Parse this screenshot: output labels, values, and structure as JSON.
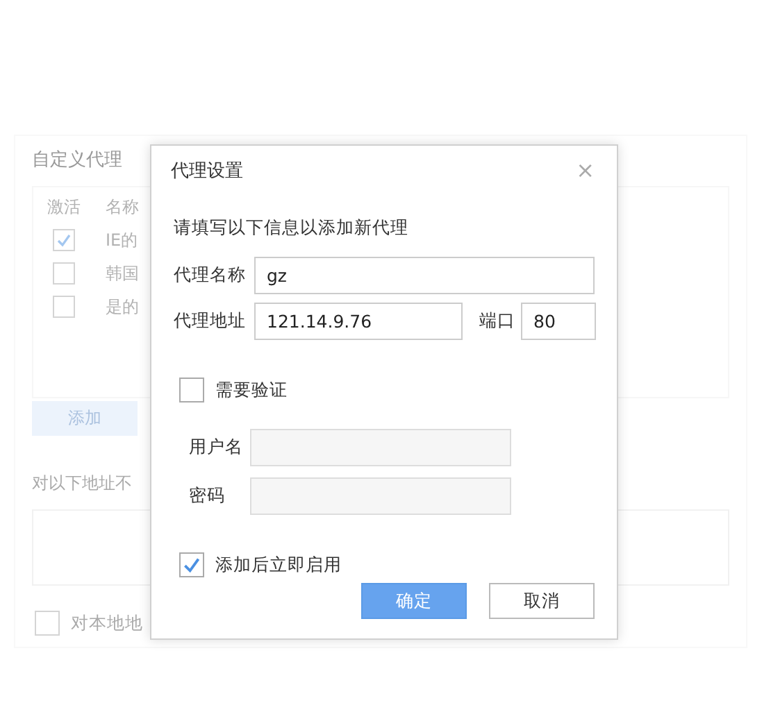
{
  "background_panel": {
    "title": "自定义代理",
    "columns": [
      "激活",
      "名称"
    ],
    "rows": [
      {
        "checked": true,
        "name": "IE的"
      },
      {
        "checked": false,
        "name": "韩国"
      },
      {
        "checked": false,
        "name": "是的"
      }
    ],
    "add_button": "添加",
    "bypass_label": "对以下地址不",
    "local_checkbox": {
      "label": "对本地地",
      "checked": false
    }
  },
  "dialog": {
    "title": "代理设置",
    "close": "×",
    "intro": "请填写以下信息以添加新代理",
    "name_field": {
      "label": "代理名称",
      "value": "gz"
    },
    "address_field": {
      "label": "代理地址",
      "value": "121.14.9.76"
    },
    "port_field": {
      "label": "端口",
      "value": "80"
    },
    "auth_checkbox": {
      "label": "需要验证",
      "checked": false
    },
    "username_field": {
      "label": "用户名",
      "disabled": true
    },
    "password_field": {
      "label": "密码",
      "disabled": true
    },
    "enable_checkbox": {
      "label": "添加后立即启用",
      "checked": true
    },
    "buttons": [
      {
        "label": "确定",
        "kind": "primary"
      },
      {
        "label": "取消",
        "kind": "secondary"
      }
    ]
  }
}
